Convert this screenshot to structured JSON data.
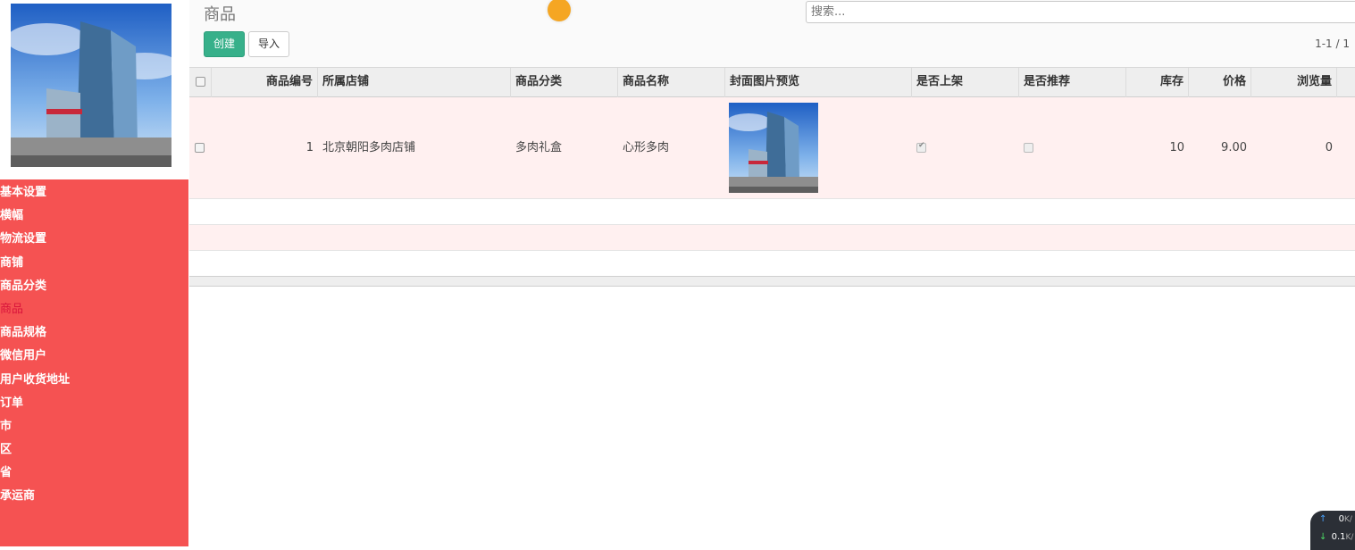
{
  "sidebar": {
    "menu": [
      {
        "label": "基本设置",
        "active": false
      },
      {
        "label": "横幅",
        "active": false
      },
      {
        "label": "物流设置",
        "active": false
      },
      {
        "label": "商铺",
        "active": false
      },
      {
        "label": "商品分类",
        "active": false
      },
      {
        "label": "商品",
        "active": true
      },
      {
        "label": "商品规格",
        "active": false
      },
      {
        "label": "微信用户",
        "active": false
      },
      {
        "label": "用户收货地址",
        "active": false
      },
      {
        "label": "订单",
        "active": false
      },
      {
        "label": "市",
        "active": false
      },
      {
        "label": "区",
        "active": false
      },
      {
        "label": "省",
        "active": false
      },
      {
        "label": "承运商",
        "active": false
      }
    ]
  },
  "header": {
    "title": "商品",
    "search_placeholder": "搜索...",
    "create_label": "创建",
    "import_label": "导入",
    "pager": "1-1 / 1"
  },
  "table": {
    "columns": [
      "商品编号",
      "所属店铺",
      "商品分类",
      "商品名称",
      "封面图片预览",
      "是否上架",
      "是否推荐",
      "库存",
      "价格",
      "浏览量"
    ],
    "rows": [
      {
        "id": "1",
        "shop": "北京朝阳多肉店铺",
        "category": "多肉礼盒",
        "name": "心形多肉",
        "on_shelf": true,
        "recommended": false,
        "stock": "10",
        "price": "9.00",
        "views": "0"
      }
    ]
  },
  "net_widget": {
    "up": "0",
    "down": "0.1",
    "unit": "K/"
  },
  "colors": {
    "sidebar": "#f55252",
    "primary_button": "#37b08a",
    "active_menu": "#d9143b"
  }
}
